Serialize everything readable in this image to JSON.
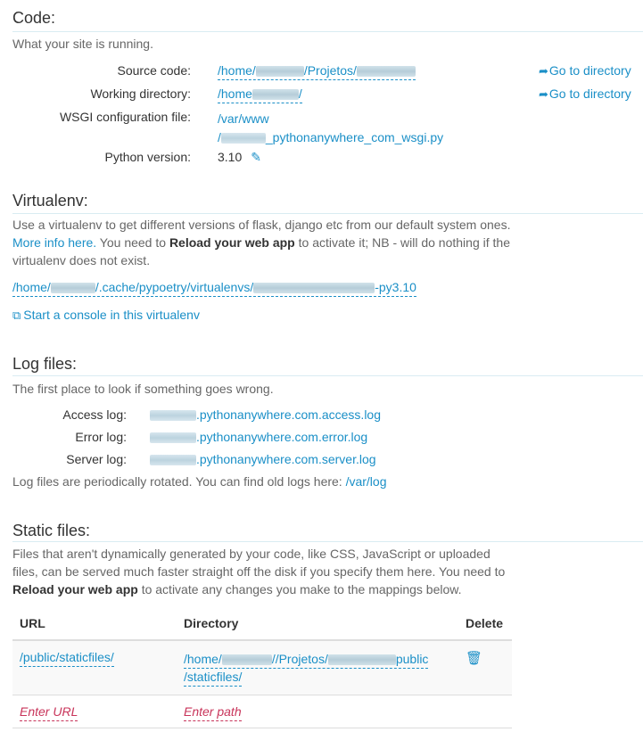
{
  "code": {
    "title": "Code:",
    "subtitle": "What your site is running.",
    "source_label": "Source code:",
    "source_prefix": "/home/",
    "source_mid": "/Projetos/",
    "working_label": "Working directory:",
    "working_prefix": "/home",
    "working_suffix": "/",
    "wsgi_label": "WSGI configuration file:",
    "wsgi_line1": "/var/www",
    "wsgi_line2_prefix": "/",
    "wsgi_line2_suffix": "_pythonanywhere_com_wsgi.py",
    "python_label": "Python version:",
    "python_value": "3.10",
    "goto_label": "Go to directory"
  },
  "virtualenv": {
    "title": "Virtualenv:",
    "intro_a": "Use a virtualenv to get different versions of flask, django etc from our default system ones. ",
    "more_info": "More info here.",
    "intro_b": " You need to ",
    "reload": "Reload your web app",
    "intro_c": " to activate it; NB - will do nothing if the virtualenv does not exist.",
    "path_prefix": "/home/",
    "path_mid": "/.cache/pypoetry/virtualenvs/",
    "path_suffix": "-py3.10",
    "console_link": "Start a console in this virtualenv"
  },
  "logs": {
    "title": "Log files:",
    "subtitle": "The first place to look if something goes wrong.",
    "access_label": "Access log:",
    "access_value": ".pythonanywhere.com.access.log",
    "error_label": "Error log:",
    "error_value": ".pythonanywhere.com.error.log",
    "server_label": "Server log:",
    "server_value": ".pythonanywhere.com.server.log",
    "rotated_text": "Log files are periodically rotated. You can find old logs here: ",
    "rotated_link": "/var/log"
  },
  "static": {
    "title": "Static files:",
    "intro_a": "Files that aren't dynamically generated by your code, like CSS, JavaScript or uploaded files, can be served much faster straight off the disk if you specify them here. You need to ",
    "reload": "Reload your web app",
    "intro_b": " to activate any changes you make to the mappings below.",
    "headers": {
      "url": "URL",
      "directory": "Directory",
      "delete": "Delete"
    },
    "row_url": "/public/staticfiles/",
    "row_dir_prefix": "/home/",
    "row_dir_mid": "//Projetos/",
    "row_dir_suffix1": "public",
    "row_dir_suffix2": "/staticfiles/",
    "enter_url": "Enter URL",
    "enter_path": "Enter path"
  },
  "icons": {
    "goto": "share-arrow-icon",
    "edit": "pencil-icon",
    "console": "external-console-icon",
    "delete": "trash-icon"
  },
  "colors": {
    "link": "#1a8fc7",
    "placeholder": "#c8345a",
    "rule": "#d9ecf2"
  }
}
